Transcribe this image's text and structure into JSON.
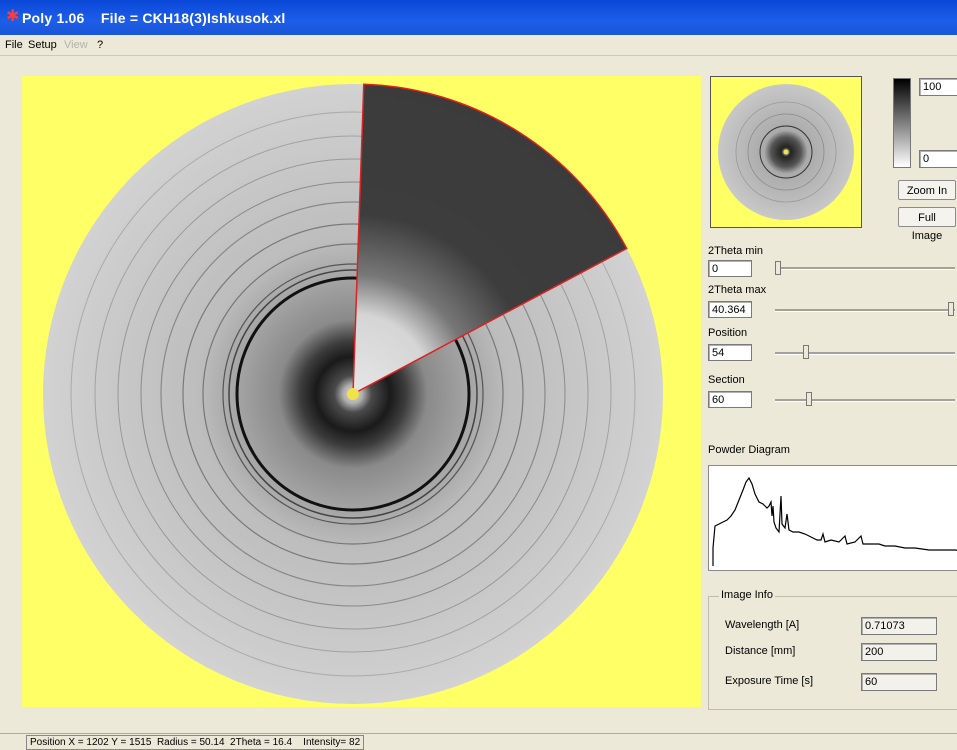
{
  "window": {
    "title": "Poly 1.06    File = CKH18(3)Ishkusok.xl"
  },
  "menu": [
    {
      "label": "File",
      "enabled": true
    },
    {
      "label": "Setup",
      "enabled": true
    },
    {
      "label": "View",
      "enabled": false
    },
    {
      "label": "?",
      "enabled": true
    }
  ],
  "intensity": {
    "max": "100",
    "min": "0"
  },
  "buttons": {
    "zoom_in": "Zoom In",
    "full_image": "Full Image"
  },
  "params": {
    "twotheta_min": {
      "label": "2Theta min",
      "value": "0"
    },
    "twotheta_max": {
      "label": "2Theta max",
      "value": "40.364"
    },
    "position": {
      "label": "Position",
      "value": "54"
    },
    "section": {
      "label": "Section",
      "value": "60"
    }
  },
  "powder": {
    "label": "Powder Diagram"
  },
  "image_info": {
    "title": "Image Info",
    "rows": [
      {
        "label": "Wavelength [A]",
        "value": "0.71073"
      },
      {
        "label": "Distance [mm]",
        "value": "200"
      },
      {
        "label": "Exposure Time [s]",
        "value": "60"
      }
    ]
  },
  "status": {
    "text": "Position X = 1202 Y = 1515  Radius = 50.14  2Theta = 16.4    Intensity= 82"
  },
  "colors": {
    "background": "#ffff66",
    "section_outline": "#dd2222",
    "titlebar": "#1d5ee9"
  }
}
